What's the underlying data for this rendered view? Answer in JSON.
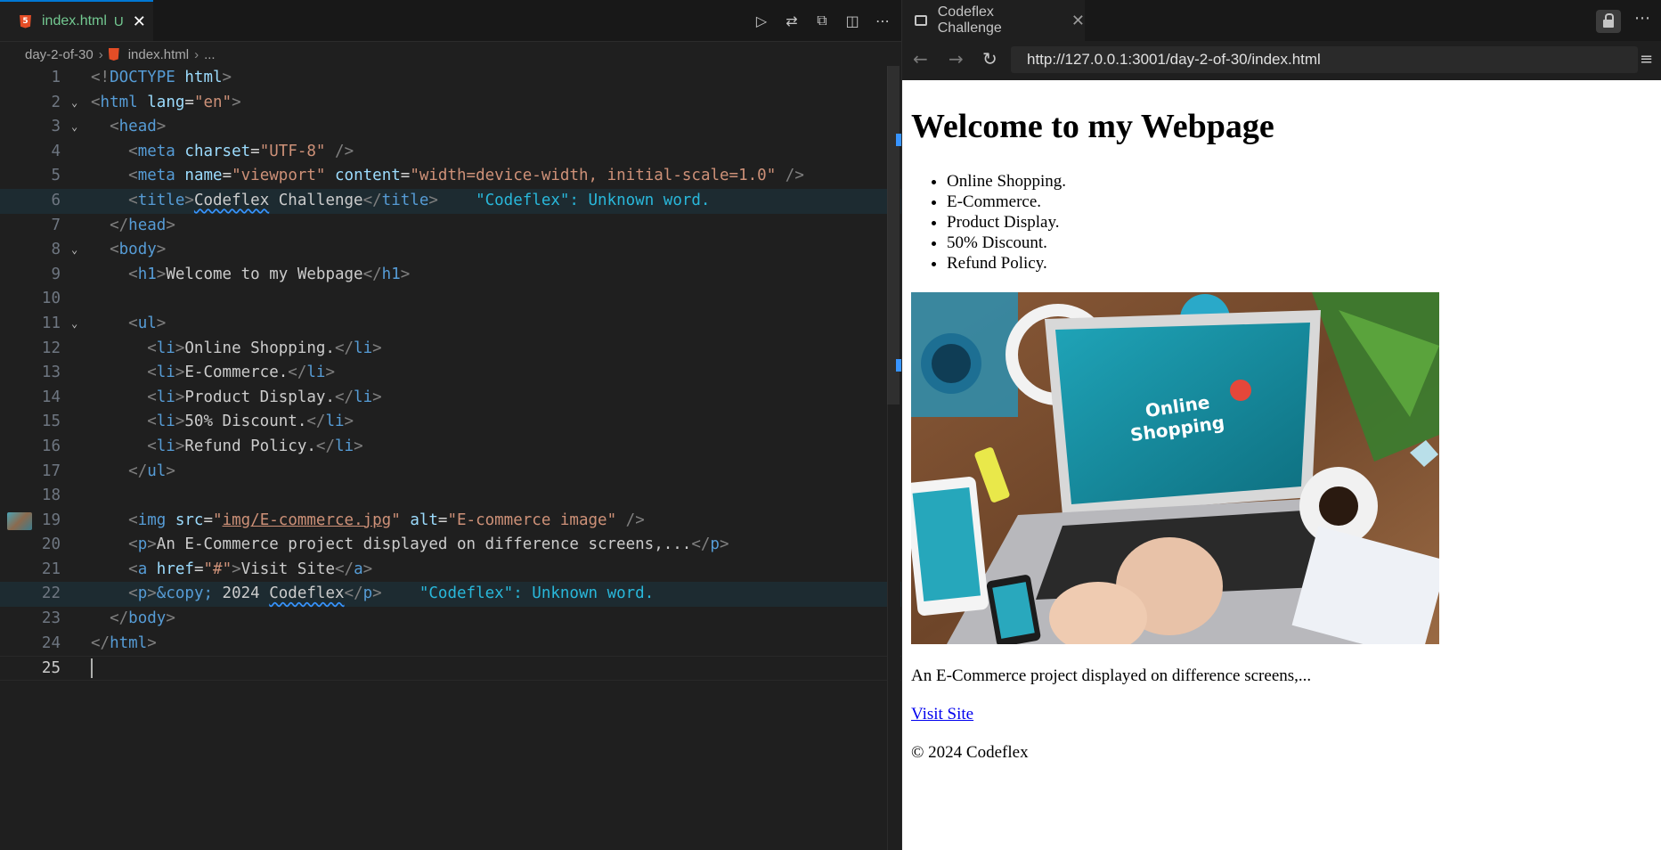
{
  "editor": {
    "tab": {
      "filename": "index.html",
      "status": "U"
    },
    "breadcrumb": [
      "day-2-of-30",
      "index.html",
      "..."
    ],
    "diagnostic": "\"Codeflex\": Unknown word.",
    "line_numbers": [
      "1",
      "2",
      "3",
      "4",
      "5",
      "6",
      "7",
      "8",
      "9",
      "10",
      "11",
      "12",
      "13",
      "14",
      "15",
      "16",
      "17",
      "18",
      "19",
      "20",
      "21",
      "22",
      "23",
      "24",
      "25"
    ]
  },
  "browser": {
    "tab_title": "Codeflex Challenge",
    "url": "http://127.0.0.1:3001/day-2-of-30/index.html",
    "page": {
      "heading": "Welcome to my Webpage",
      "items": [
        "Online Shopping.",
        "E-Commerce.",
        "Product Display.",
        "50% Discount.",
        "Refund Policy."
      ],
      "image_alt": "E-commerce image",
      "description": "An E-Commerce project displayed on difference screens,...",
      "link": "Visit Site",
      "footer": "© 2024 Codeflex"
    }
  },
  "colors": {
    "accent": "#0078d4",
    "tag": "#569cd6",
    "attr": "#9cdcfe",
    "string": "#ce9178",
    "diagnostic": "#29b8db",
    "link": "#0000ee"
  }
}
